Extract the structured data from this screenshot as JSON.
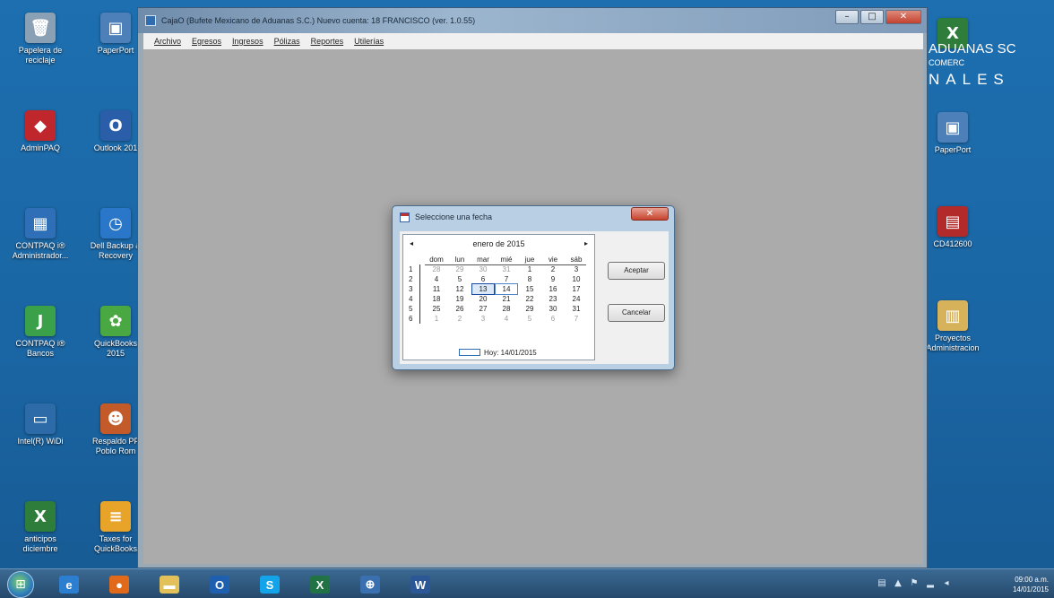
{
  "desktop": {
    "left_column": [
      {
        "label": "Papelera de reciclaje",
        "icon": "recycle-bin-icon",
        "color": "#8aa0b4",
        "glyph": "🗑"
      },
      {
        "label": "AdminPAQ",
        "icon": "adminpaq-icon",
        "color": "#c0272d",
        "glyph": "◆"
      },
      {
        "label": "CONTPAQ i® Administrador...",
        "icon": "contpaq-admin-icon",
        "color": "#2e6fb7",
        "glyph": "▦"
      },
      {
        "label": "CONTPAQ i® Bancos",
        "icon": "contpaq-bancos-icon",
        "color": "#3aa04a",
        "glyph": "J"
      },
      {
        "label": "Intel(R) WiDi",
        "icon": "intel-widi-icon",
        "color": "#2c6aa8",
        "glyph": "▭"
      },
      {
        "label": "anticipos diciembre",
        "icon": "excel-file-icon",
        "color": "#2f7d3b",
        "glyph": "X"
      }
    ],
    "second_column": [
      {
        "label": "PaperPort",
        "icon": "paperport-icon",
        "color": "#4d7fb8",
        "glyph": "▣"
      },
      {
        "label": "Outlook 201",
        "icon": "outlook-shortcut-icon",
        "color": "#2a5ea8",
        "glyph": "O"
      },
      {
        "label": "Dell Backup & Recovery",
        "icon": "dell-backup-icon",
        "color": "#2a77c9",
        "glyph": "◷"
      },
      {
        "label": "QuickBooks 2015",
        "icon": "quickbooks-icon",
        "color": "#4aa843",
        "glyph": "✿"
      },
      {
        "label": "Respaldo PF Poblo Rom",
        "icon": "respaldo-user-icon",
        "color": "#c35a2a",
        "glyph": "☻"
      },
      {
        "label": "Taxes for QuickBooks",
        "icon": "taxes-quickbooks-icon",
        "color": "#e8a329",
        "glyph": "≡"
      }
    ],
    "right_column": [
      {
        "label": "",
        "icon": "spreadsheet-file-icon",
        "color": "#2f7d3b",
        "glyph": "X"
      },
      {
        "label": "PaperPort",
        "icon": "paperport-right-icon",
        "color": "#4d7fb8",
        "glyph": "▣"
      },
      {
        "label": "CD412600",
        "icon": "pdf-file-icon",
        "color": "#b32a2a",
        "glyph": "▤"
      },
      {
        "label": "Proyectos Administracion",
        "icon": "folder-docs-icon",
        "color": "#d6b25a",
        "glyph": "▥"
      }
    ],
    "banner": {
      "line1": "ADUANAS SC",
      "line2": "COMERC",
      "line3": "NALES"
    }
  },
  "app": {
    "title": "CajaO (Bufete Mexicano de Aduanas S.C.) Nuevo cuenta: 18 FRANCISCO (ver. 1.0.55)",
    "menu": [
      "Archivo",
      "Egresos",
      "Ingresos",
      "Pólizas",
      "Reportes",
      "Utilerías"
    ],
    "controls": {
      "minimize": "–",
      "maximize": "□",
      "close": "✕"
    }
  },
  "dialog": {
    "title": "Seleccione una fecha",
    "close": "✕",
    "month_label": "enero de 2015",
    "prev": "◂",
    "next": "▸",
    "day_headers": [
      "dom",
      "lun",
      "mar",
      "mié",
      "jue",
      "vie",
      "sáb"
    ],
    "weeks": [
      {
        "num": "1",
        "days": [
          {
            "d": "28",
            "dim": true
          },
          {
            "d": "29",
            "dim": true
          },
          {
            "d": "30",
            "dim": true
          },
          {
            "d": "31",
            "dim": true
          },
          {
            "d": "1"
          },
          {
            "d": "2"
          },
          {
            "d": "3"
          }
        ]
      },
      {
        "num": "2",
        "days": [
          {
            "d": "4"
          },
          {
            "d": "5"
          },
          {
            "d": "6"
          },
          {
            "d": "7"
          },
          {
            "d": "8"
          },
          {
            "d": "9"
          },
          {
            "d": "10"
          }
        ]
      },
      {
        "num": "3",
        "days": [
          {
            "d": "11"
          },
          {
            "d": "12"
          },
          {
            "d": "13",
            "sel": true
          },
          {
            "d": "14",
            "today": true
          },
          {
            "d": "15"
          },
          {
            "d": "16"
          },
          {
            "d": "17"
          }
        ]
      },
      {
        "num": "4",
        "days": [
          {
            "d": "18"
          },
          {
            "d": "19"
          },
          {
            "d": "20"
          },
          {
            "d": "21"
          },
          {
            "d": "22"
          },
          {
            "d": "23"
          },
          {
            "d": "24"
          }
        ]
      },
      {
        "num": "5",
        "days": [
          {
            "d": "25"
          },
          {
            "d": "26"
          },
          {
            "d": "27"
          },
          {
            "d": "28"
          },
          {
            "d": "29"
          },
          {
            "d": "30"
          },
          {
            "d": "31"
          }
        ]
      },
      {
        "num": "6",
        "days": [
          {
            "d": "1",
            "dim": true
          },
          {
            "d": "2",
            "dim": true
          },
          {
            "d": "3",
            "dim": true
          },
          {
            "d": "4",
            "dim": true
          },
          {
            "d": "5",
            "dim": true
          },
          {
            "d": "6",
            "dim": true
          },
          {
            "d": "7",
            "dim": true
          }
        ]
      }
    ],
    "today_text": "Hoy: 14/01/2015",
    "ok_label": "Aceptar",
    "cancel_label": "Cancelar"
  },
  "taskbar": {
    "start": "⊞",
    "apps": [
      {
        "name": "ie",
        "label": "e",
        "color": "#2c7fd0",
        "icon": "internet-explorer-icon"
      },
      {
        "name": "firefox",
        "label": "●",
        "color": "#e06a1a",
        "icon": "firefox-icon"
      },
      {
        "name": "explorer",
        "label": "▬",
        "color": "#e2c15a",
        "icon": "file-explorer-icon"
      },
      {
        "name": "outlook",
        "label": "O",
        "color": "#1f5fb0",
        "icon": "outlook-icon"
      },
      {
        "name": "skype",
        "label": "S",
        "color": "#13a3e8",
        "icon": "skype-icon"
      },
      {
        "name": "excel",
        "label": "X",
        "color": "#217346",
        "icon": "excel-icon"
      },
      {
        "name": "app",
        "label": "⊕",
        "color": "#3a6fb0",
        "icon": "network-app-icon"
      },
      {
        "name": "word",
        "label": "W",
        "color": "#2b5797",
        "icon": "word-icon"
      }
    ],
    "tray_icons": [
      "▤",
      "▲",
      "⚑",
      "▂",
      "◂"
    ],
    "time": "09:00 a.m.",
    "date": "14/01/2015"
  }
}
